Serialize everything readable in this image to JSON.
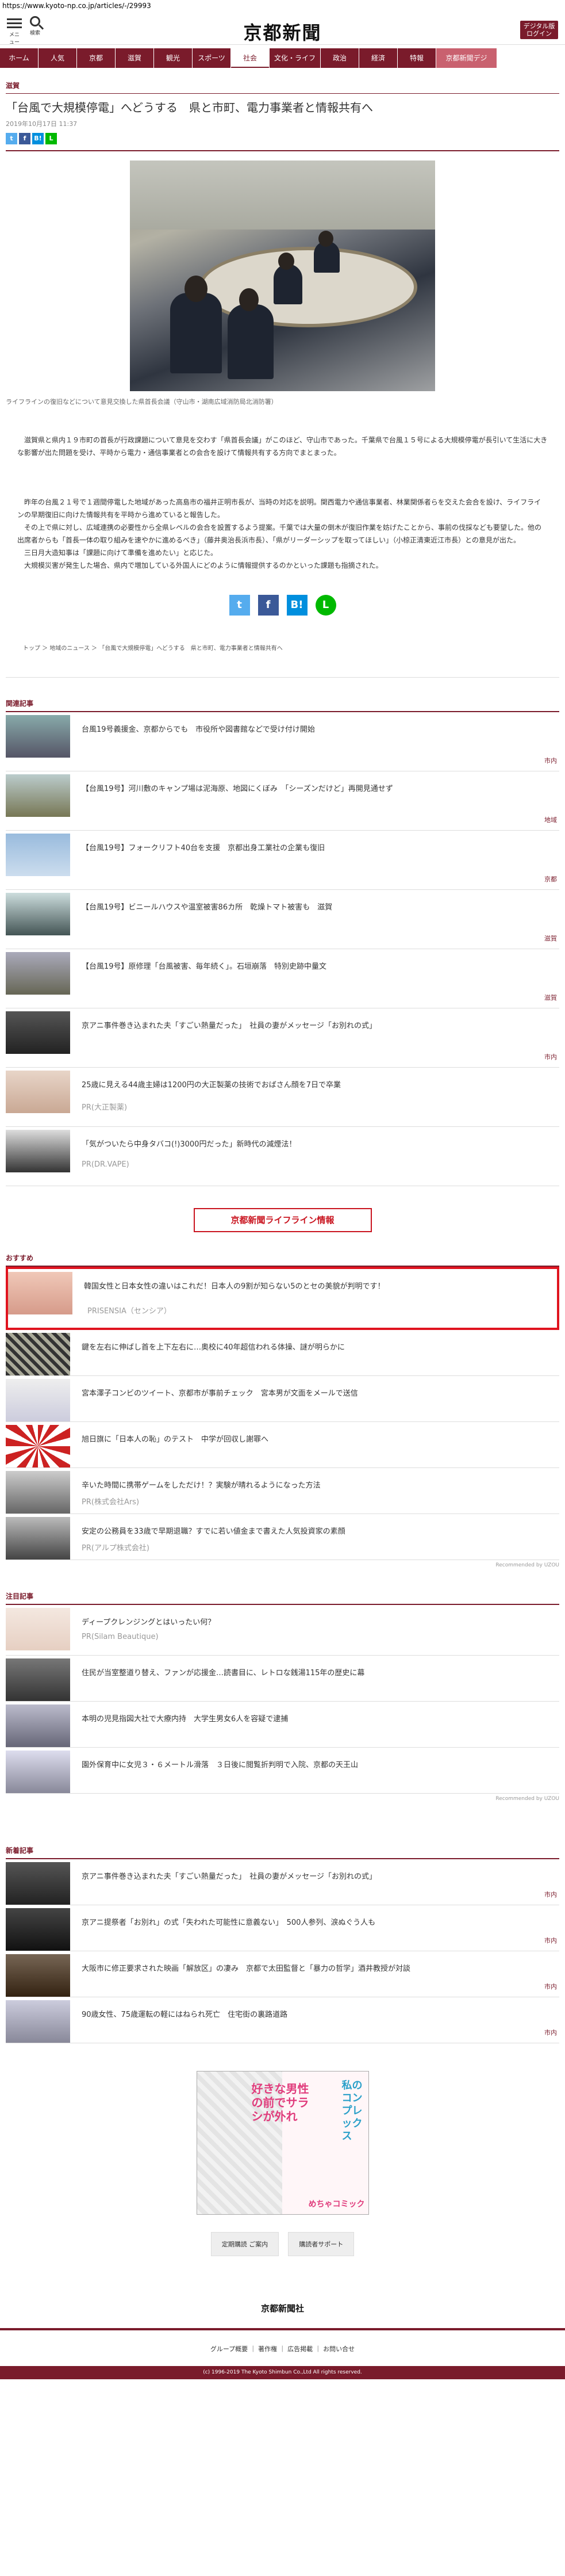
{
  "url": "https://www.kyoto-np.co.jp/articles/-/29993",
  "header": {
    "menu_label": "メニュー",
    "search_label": "検索",
    "logo": "京都新聞",
    "digital_line1": "デジタル版",
    "digital_line2": "ログイン"
  },
  "nav": [
    "ホーム",
    "人気",
    "京都",
    "滋賀",
    "観光",
    "スポーツ",
    "社会",
    "文化・ライフ",
    "政治",
    "経済",
    "特報",
    "京都新聞デジ"
  ],
  "nav_active_index": 6,
  "article": {
    "category": "滋賀",
    "headline": "「台風で大規模停電」へどうする　県と市町、電力事業者と情報共有へ",
    "date": "2019年10月17日 11:37",
    "caption": "ライフラインの復旧などについて意見交換した県首長会議（守山市・湖南広域消防局北消防署）",
    "paragraphs": [
      "　滋賀県と県内１９市町の首長が行政課題について意見を交わす「県首長会議」がこのほど、守山市であった。千葉県で台風１５号による大規模停電が長引いて生活に大きな影響が出た問題を受け、平時から電力・通信事業者との会合を設けて情報共有する方向でまとまった。",
      "　昨年の台風２１号で１週間停電した地域があった高島市の福井正明市長が、当時の対応を説明。関西電力や通信事業者、林業関係者らを交えた会合を設け、ライフラインの早期復旧に向けた情報共有を平時から進めていると報告した。\n　その上で県に対し、広域連携の必要性から全県レベルの会合を設置するよう提案。千葉では大量の倒木が復旧作業を妨げたことから、事前の伐採なども要望した。他の出席者からも「首長一体の取り組みを速やかに進めるべき」（藤井奥治長浜市長）、「県がリーダーシップを取ってほしい」（小椋正清東近江市長）との意見が出た。\n　三日月大造知事は「課題に向けて準備を進めたい」と応じた。\n　大規模災害が発生した場合、県内で増加している外国人にどのように情報提供するのかといった課題も指摘された。"
    ],
    "share": {
      "twitter": "t",
      "facebook": "f",
      "hatena": "B!",
      "line": "L"
    },
    "breadcrumb": "トップ ＞ 地域のニュース ＞ 「台風で大規模停電」へどうする　県と市町、電力事業者と情報共有へ"
  },
  "related": {
    "title": "関連記事",
    "items": [
      {
        "title": "台風19号義援金、京都からでも　市役所や図書館などで受け付け開始",
        "tag": "市内"
      },
      {
        "title": "【台風19号】河川敷のキャンプ場は泥海原、地図にくぼみ　「シーズンだけど」再開見通せず",
        "tag": "地域"
      },
      {
        "title": "【台風19号】フォークリフト40台を支援　京都出身工業社の企業も復旧",
        "tag": "京都"
      },
      {
        "title": "【台風19号】ビニールハウスや温室被害86カ所　乾燥トマト被害も　滋賀",
        "tag": "滋賀"
      },
      {
        "title": "【台風19号】原修理「台風被害、毎年続く」。石垣崩落　特別史跡中量文",
        "tag": "滋賀"
      },
      {
        "title": "京アニ事件巻き込まれた夫「すごい熱量だった」　社員の妻がメッセージ「お別れの式」",
        "tag": "市内"
      },
      {
        "title": "25歳に見える44歳主婦は1200円の大正製薬の技術でおばさん顔を7日で卒業",
        "pr": "PR(大正製薬)"
      },
      {
        "title": "「気がついたら中身タバコ(!)3000円だった」新時代の減煙法！",
        "pr": "PR(DR.VAPE)"
      }
    ]
  },
  "lifeline": "京都新聞ライフライン情報",
  "recommend": {
    "title": "おすすめ",
    "items": [
      {
        "title": "韓国女性と日本女性の違いはこれだ！日本人の9割が知らない5のとセの美貌が判明です！",
        "pr": "PRISENSIA（センシア）"
      },
      {
        "title": "鍵を左右に伸ばし首を上下左右に…奥校に40年超信われる体操、謎が明らかに"
      },
      {
        "title": "宮本澤子コンビのツイート、京都市が事前チェック　宮本男が文面をメールで送信"
      },
      {
        "title": "旭日旗に「日本人の恥」のテスト　中学が回収し謝罪へ"
      },
      {
        "title": "辛いた時間に携帯ゲームをしただけ！？実験が晴れるようになった方法",
        "pr": "PR(株式会社Ars)"
      },
      {
        "title": "安定の公務員を33歳で早期退職？すでに若い値金まで書えた人気投資家の素顔",
        "pr": "PR(アルプ株式会社)"
      }
    ],
    "by": "Recommended by UZOU"
  },
  "attention": {
    "title": "注目記事",
    "items": [
      {
        "title": "ディープクレンジングとはいったい何？",
        "pr": "PR(Silam Beautique)"
      },
      {
        "title": "住民が当室整道り替え、ファンが応援金…読書目に、レトロな銭湯115年の歴史に幕"
      },
      {
        "title": "本明の児見指図大社で大療内持　大学生男女6人を容疑で逮捕"
      },
      {
        "title": "園外保育中に女児３・６メートル滑落　３日後に閲覧折判明で入院、京都の天王山"
      }
    ],
    "by": "Recommended by UZOU"
  },
  "new_articles": {
    "title": "新着記事",
    "items": [
      {
        "title": "京アニ事件巻き込まれた夫「すごい熱量だった」　社員の妻がメッセージ「お別れの式」",
        "tag": "市内"
      },
      {
        "title": "京アニ提祭者「お別れ」の式「失われた可能性に意義ない」　500人参列、涙ぬぐう人も",
        "tag": "市内"
      },
      {
        "title": "大阪市に修正要求された映画「解放区」の凄み　京都で太田監督と「暴力の哲学」酒井教授が対談",
        "tag": "市内"
      },
      {
        "title": "90歳女性、75歳運転の軽にはねられ死亡　住宅街の裏路道路",
        "tag": "市内"
      }
    ]
  },
  "ad": {
    "t1": "好きな男性の前でサラシが外れ",
    "t2": "私のコンプレックス",
    "t3": "めちゃコミック"
  },
  "footer": {
    "btn_subscribe": "定期購読 ご案内",
    "btn_support": "購読者サポート",
    "logo": "京都新聞社",
    "links": "グループ概要 ｜ 著作権 ｜ 広告掲載 ｜ お問い合せ",
    "copyright": "(c) 1996-2019 The Kyoto Shimbun Co.,Ltd All rights reserved."
  },
  "colors": {
    "brand": "#7a1b2b",
    "highlight_border": "#e0141f",
    "twitter": "#55acee",
    "facebook": "#3b5998",
    "hatena": "#008fde",
    "line": "#00b900"
  }
}
